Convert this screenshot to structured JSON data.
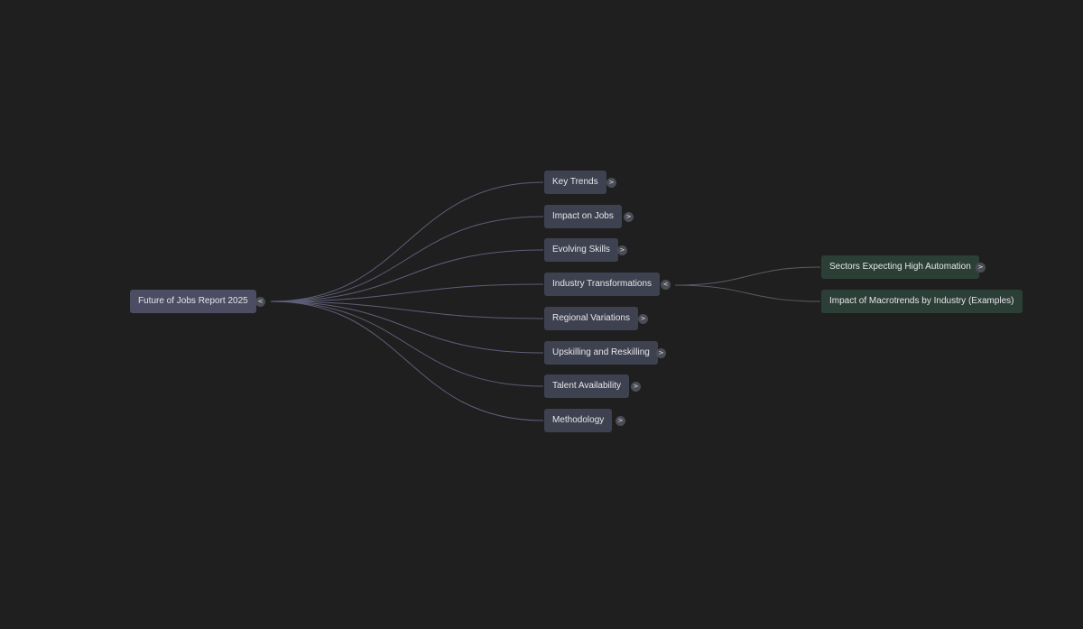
{
  "mindmap": {
    "root": {
      "label": "Future of Jobs Report 2025",
      "toggle": "<",
      "expanded": true
    },
    "branches": [
      {
        "label": "Key Trends",
        "toggle": ">",
        "expanded": false
      },
      {
        "label": "Impact on Jobs",
        "toggle": ">",
        "expanded": false
      },
      {
        "label": "Evolving Skills",
        "toggle": ">",
        "expanded": false
      },
      {
        "label": "Industry Transformations",
        "toggle": "<",
        "expanded": true,
        "children": [
          {
            "label": "Sectors Expecting High Automation",
            "toggle": ">",
            "expanded": false
          },
          {
            "label": "Impact of Macrotrends by Industry (Examples)"
          }
        ]
      },
      {
        "label": "Regional Variations",
        "toggle": ">",
        "expanded": false
      },
      {
        "label": "Upskilling and Reskilling",
        "toggle": ">",
        "expanded": false
      },
      {
        "label": "Talent Availability",
        "toggle": ">",
        "expanded": false
      },
      {
        "label": "Methodology",
        "toggle": ">",
        "expanded": false
      }
    ]
  },
  "colors": {
    "background": "#1f1f1f",
    "root_node": "#4c4c63",
    "branch_node": "#3e4250",
    "leaf_node": "#2c3f37",
    "edge_root": "#5e5e78",
    "edge_child": "#5a5d66"
  }
}
